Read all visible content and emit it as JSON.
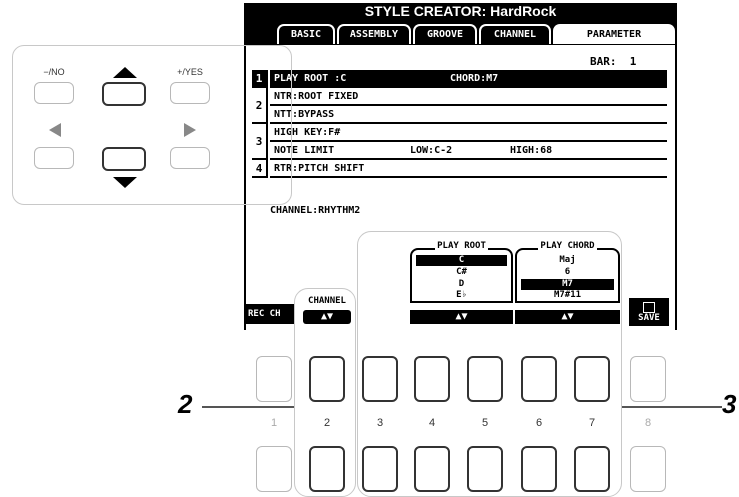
{
  "header": {
    "title": "STYLE CREATOR: HardRock"
  },
  "tabs": [
    "BASIC",
    "ASSEMBLY",
    "GROOVE",
    "CHANNEL",
    "PARAMETER"
  ],
  "bar": {
    "label": "BAR:",
    "value": "1"
  },
  "params": [
    {
      "num": "1",
      "text": "PLAY ROOT   :C",
      "extra": "CHORD:M7"
    },
    {
      "num": "2",
      "text": "NTR:ROOT FIXED"
    },
    {
      "text": "NTT:BYPASS"
    },
    {
      "num": "3",
      "text": "HIGH KEY:F#"
    },
    {
      "text": "NOTE LIMIT",
      "low": "LOW:C-2",
      "high": "HIGH:68"
    },
    {
      "num": "4",
      "text": "RTR:PITCH SHIFT"
    }
  ],
  "channel": {
    "label": "CHANNEL:RHYTHM2"
  },
  "play_root": {
    "title": "PLAY ROOT",
    "items": [
      "C",
      "C#",
      "D",
      "E♭"
    ],
    "selected": "C",
    "arrows": "▲▼"
  },
  "play_chord": {
    "title": "PLAY CHORD",
    "items": [
      "Maj",
      "6",
      "M7",
      "M7#11"
    ],
    "selected": "M7",
    "arrows": "▲▼"
  },
  "soft": {
    "rec_ch": "REC CH",
    "channel": "CHANNEL",
    "channel_arrows": "▲▼",
    "save": "SAVE"
  },
  "panel": {
    "no": "−/NO",
    "yes": "+/YES"
  },
  "button_numbers": [
    "1",
    "2",
    "3",
    "4",
    "5",
    "6",
    "7",
    "8"
  ],
  "callouts": {
    "left": "2",
    "right": "3"
  }
}
